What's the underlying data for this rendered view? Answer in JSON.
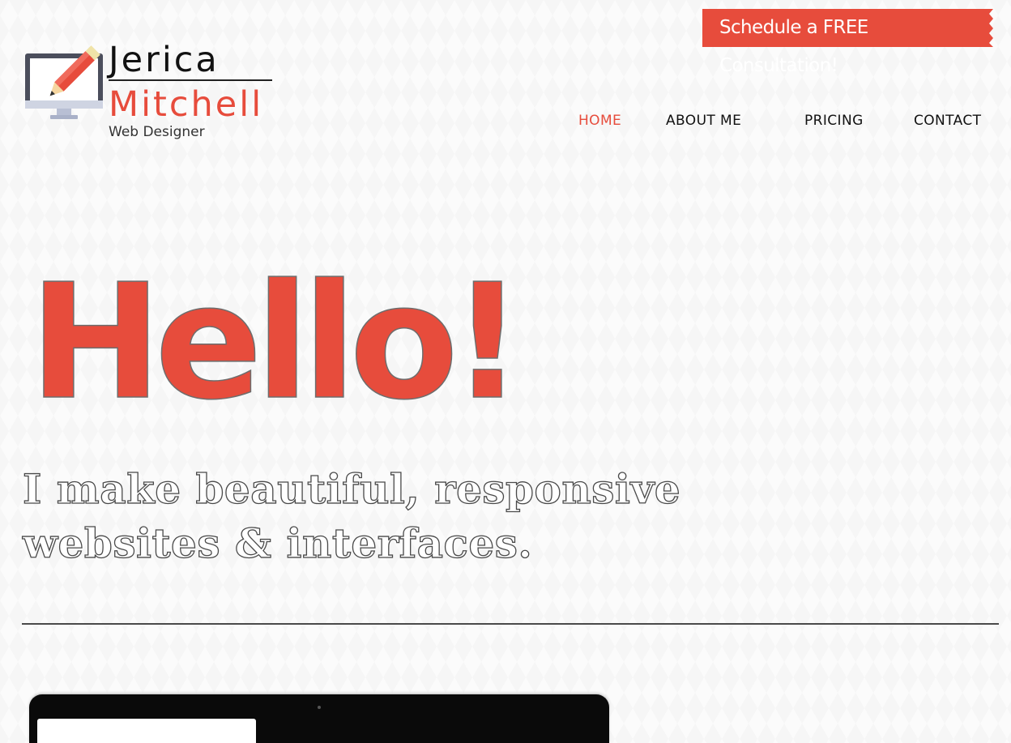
{
  "header": {
    "cta_label": "Schedule a FREE Consultation!",
    "logo": {
      "first_name": "Jerica",
      "last_name": "Mitchell",
      "tagline": "Web Designer",
      "icon": "monitor-pencil-icon"
    },
    "nav": [
      {
        "label": "HOME",
        "active": true
      },
      {
        "label": "ABOUT ME",
        "active": false
      },
      {
        "label": "PRICING",
        "active": false
      },
      {
        "label": "CONTACT",
        "active": false
      }
    ]
  },
  "hero": {
    "title": "Hello!",
    "subtitle": "I make beautiful, responsive websites & interfaces."
  },
  "colors": {
    "accent": "#e74c3c",
    "text": "#111111",
    "background": "#fbfbfb"
  }
}
